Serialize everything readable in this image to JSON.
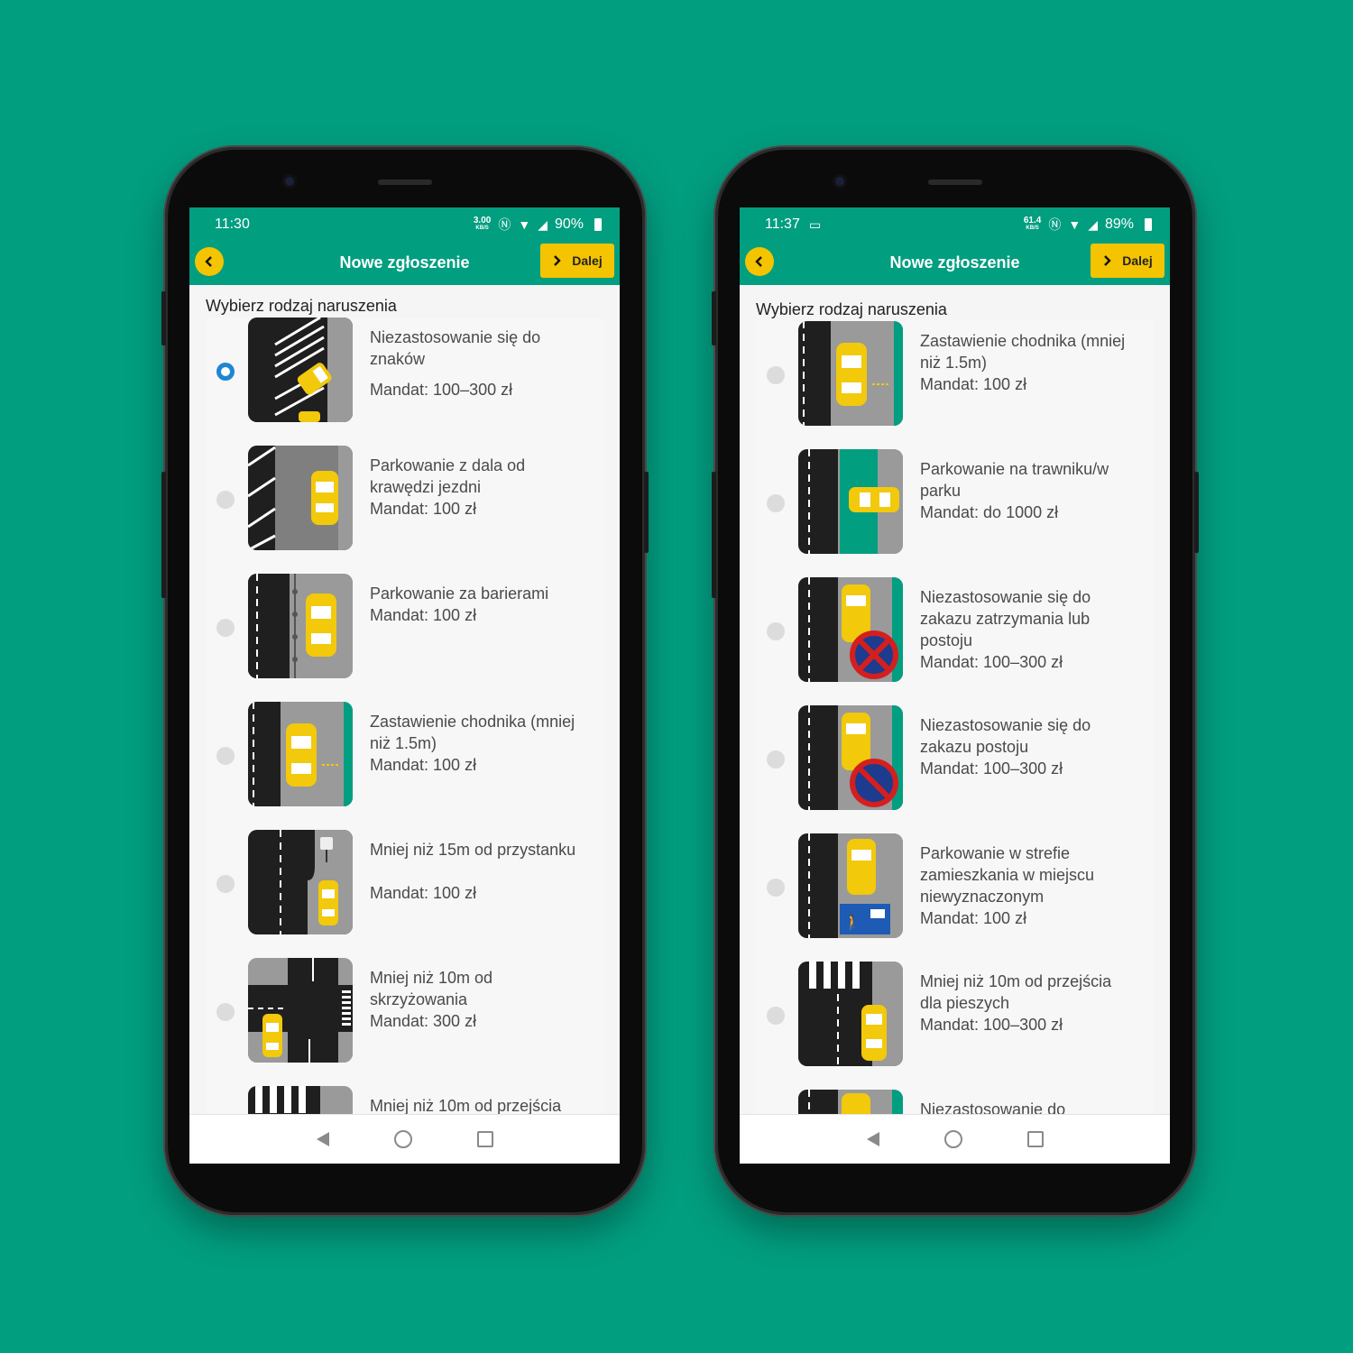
{
  "colors": {
    "background": "#029e80",
    "accent": "#f4c400",
    "radio_selected": "#1f86d1"
  },
  "left": {
    "status": {
      "time": "11:30",
      "speed": "3.00",
      "speed_unit": "KB/S",
      "battery": "90%"
    },
    "appbar": {
      "title": "Nowe zgłoszenie",
      "next_label": "Dalej"
    },
    "section_title": "Wybierz rodzaj naruszenia",
    "items": [
      {
        "title": "Niezastosowanie się do znaków",
        "fine": "Mandat: 100–300 zł",
        "icon": "signs-violation-image",
        "selected": true
      },
      {
        "title": "Parkowanie z dala od krawędzi jezdni",
        "fine": "Mandat: 100 zł",
        "icon": "far-from-curb-image",
        "selected": false
      },
      {
        "title": "Parkowanie za barierami",
        "fine": "Mandat: 100 zł",
        "icon": "behind-barriers-image",
        "selected": false
      },
      {
        "title": "Zastawienie chodnika (mniej niż 1.5m)",
        "fine": "Mandat: 100 zł",
        "icon": "sidewalk-block-image",
        "selected": false
      },
      {
        "title": "Mniej niż 15m od przystanku",
        "fine": "Mandat: 100 zł",
        "icon": "bus-stop-image",
        "selected": false
      },
      {
        "title": "Mniej niż 10m od skrzyżowania",
        "fine": "Mandat: 300 zł",
        "icon": "intersection-image",
        "selected": false
      },
      {
        "title": "Mniej niż 10m od przejścia",
        "fine": "",
        "icon": "crosswalk-image",
        "selected": false
      }
    ]
  },
  "right": {
    "status": {
      "time": "11:37",
      "speed": "61.4",
      "speed_unit": "KB/S",
      "battery": "89%"
    },
    "appbar": {
      "title": "Nowe zgłoszenie",
      "next_label": "Dalej"
    },
    "section_title": "Wybierz rodzaj naruszenia",
    "items": [
      {
        "title": "Zastawienie chodnika (mniej niż 1.5m)",
        "fine": "Mandat: 100 zł",
        "icon": "sidewalk-block-image",
        "selected": false
      },
      {
        "title": "Parkowanie na trawniku/w parku",
        "fine": "Mandat: do 1000 zł",
        "icon": "lawn-parking-image",
        "selected": false
      },
      {
        "title": "Niezastosowanie się do zakazu zatrzymania lub postoju",
        "fine": "Mandat: 100–300 zł",
        "icon": "no-stopping-image",
        "selected": false
      },
      {
        "title": "Niezastosowanie się do zakazu postoju",
        "fine": "Mandat: 100–300 zł",
        "icon": "no-parking-image",
        "selected": false
      },
      {
        "title": "Parkowanie w strefie zamieszkania w miejscu niewyznaczonym",
        "fine": "Mandat: 100 zł",
        "icon": "residential-zone-image",
        "selected": false
      },
      {
        "title": "Mniej niż 10m od przejścia dla pieszych",
        "fine": "Mandat: 100–300 zł",
        "icon": "crosswalk-image",
        "selected": false
      },
      {
        "title": "Niezastosowanie do",
        "fine": "",
        "icon": "no-stopping-image",
        "selected": false
      }
    ]
  }
}
